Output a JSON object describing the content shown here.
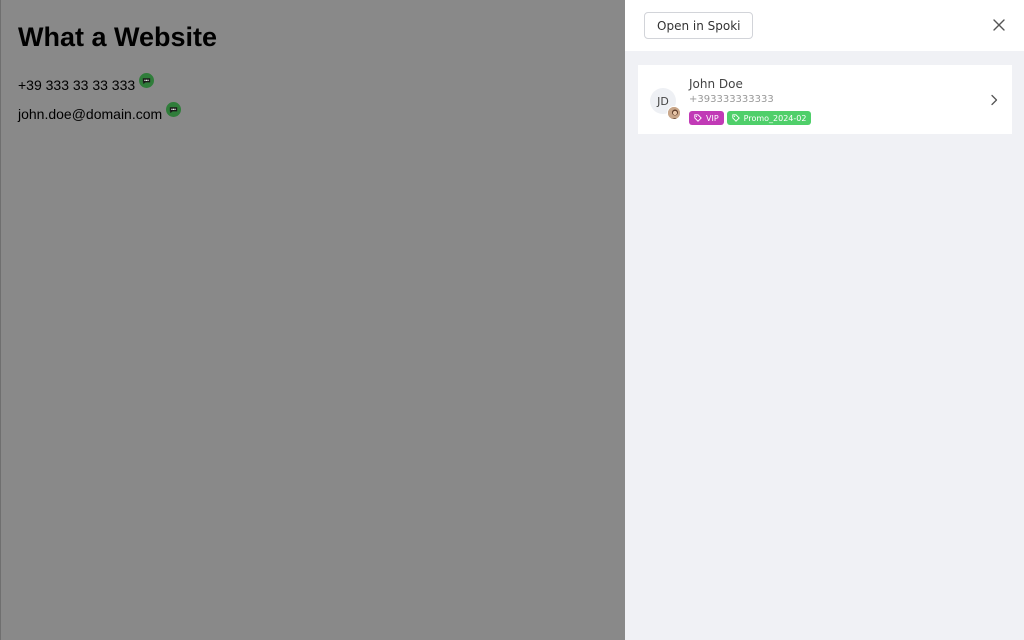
{
  "website": {
    "title": "What a Website",
    "phone": "+39 333 33 33 333",
    "email": "john.doe@domain.com"
  },
  "panel": {
    "open_button_label": "Open in Spoki",
    "contact": {
      "initials": "JD",
      "name": "John Doe",
      "phone": "+393333333333",
      "tags": [
        {
          "label": "VIP",
          "color": "#c13ab6"
        },
        {
          "label": "Promo_2024-02",
          "color": "#4fcf6a"
        }
      ]
    }
  },
  "icons": {
    "chat": "chat-bubble-icon",
    "close": "close-icon",
    "tag": "tag-icon",
    "chevron": "chevron-right-icon"
  },
  "colors": {
    "overlay": "#898989",
    "panel_bg": "#f0f1f5",
    "chat_badge": "#2f7d3a"
  }
}
